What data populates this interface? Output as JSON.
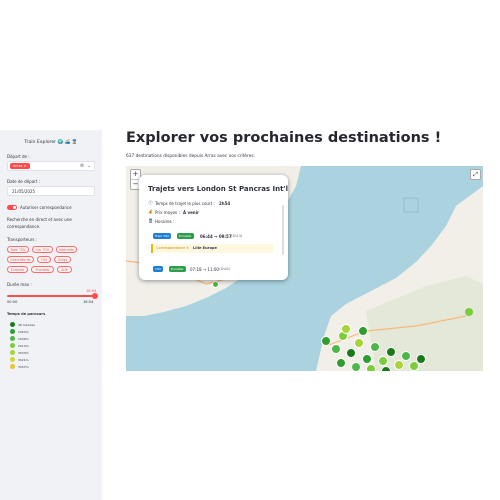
{
  "sidebar": {
    "title": "Train Explorer 🌍 🚄 🚆",
    "depart_label": "Départ de :",
    "depart_chip": "Arras",
    "date_label": "Date de départ :",
    "date_value": "21/05/2025",
    "toggle_label": "Autoriser correspondance",
    "toggle_on": true,
    "info_text": "Recherche en direct et avec une correspondance.",
    "transport_label": "Transporteurs :",
    "transporteurs": [
      "Train TGV",
      "Car TGV",
      "Intercités",
      "Intercités de nuit",
      "TGV",
      "Ouigo",
      "Eurostar",
      "Frontalis",
      "Arlé"
    ],
    "duree_label": "Durée max :",
    "duree_value": "18:54",
    "duree_min": "00:00",
    "duree_max": "18:54",
    "duree_fraction": 1.0,
    "legend_title": "Temps de parcours",
    "legend": [
      {
        "label": "46 minutes",
        "color": "#1a7a1a"
      },
      {
        "label": "1h53m",
        "color": "#2e9e2e"
      },
      {
        "label": "1h49m",
        "color": "#4cb84c"
      },
      {
        "label": "2h13m",
        "color": "#7ccc3c"
      },
      {
        "label": "3h33m",
        "color": "#a8d43a"
      },
      {
        "label": "3h21m",
        "color": "#d4d832"
      },
      {
        "label": "3h57m",
        "color": "#e8c42a"
      }
    ]
  },
  "main": {
    "title": "Explorer vos prochaines destinations !",
    "subtitle": "637 destinations disponibles depuis Arras avec vos critères."
  },
  "map": {
    "zoom_in": "+",
    "zoom_out": "−",
    "fullscreen_icon": "⤢",
    "popup": {
      "title": "Trajets vers London St Pancras Int'l",
      "shortest_label": "Temps de trajet le plus court :",
      "shortest_value": "2h54",
      "price_label": "Prix moyen :",
      "price_value": "À venir",
      "hours_label": "Horaires :",
      "trip1": {
        "badge1": "Train TGV",
        "badge2": "Eurostar",
        "time": "06:44 → 09:57",
        "dur": "(3h13)"
      },
      "correspondance_label": "Correspondance à",
      "correspondance_city": "Lille Europe",
      "trip2": {
        "badge1": "TGV",
        "badge2": "Eurostar",
        "time": "07:18 → 11:00",
        "dur": "(3h42)"
      }
    }
  }
}
